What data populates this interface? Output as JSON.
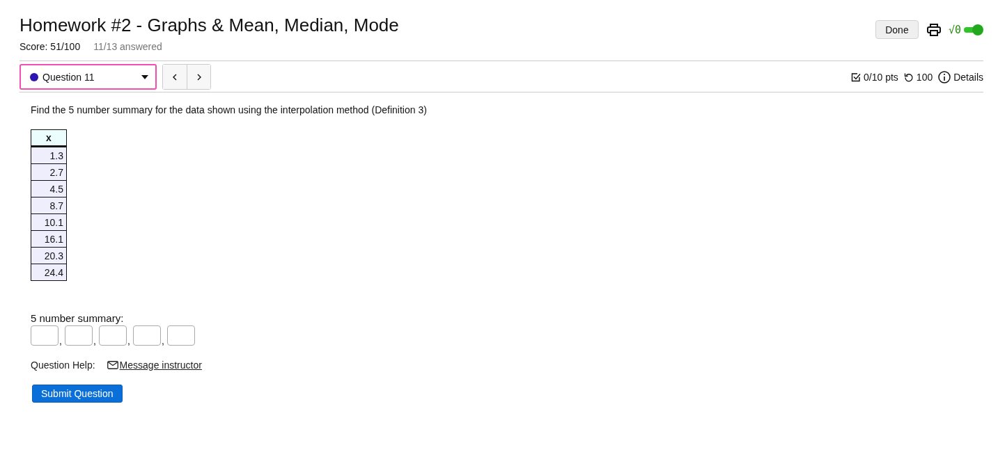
{
  "header": {
    "title": "Homework #2 - Graphs & Mean, Median, Mode",
    "score": "Score: 51/100",
    "answered": "11/13 answered",
    "done_button": "Done",
    "math_toggle": {
      "label": "√0",
      "on": true
    }
  },
  "question_bar": {
    "selector": {
      "label": "Question 11",
      "color": "#2b16b0"
    },
    "stats": {
      "points": "0/10 pts",
      "attempts": "100",
      "details": "Details"
    }
  },
  "question": {
    "prompt": "Find the 5 number summary for the data shown using the interpolation method (Definition 3)",
    "table": {
      "columns": [
        "x"
      ],
      "rows": [
        [
          "1.3"
        ],
        [
          "2.7"
        ],
        [
          "4.5"
        ],
        [
          "8.7"
        ],
        [
          "10.1"
        ],
        [
          "16.1"
        ],
        [
          "20.3"
        ],
        [
          "24.4"
        ]
      ]
    },
    "answer": {
      "label": "5 number summary:",
      "fields": [
        {
          "kind": "answer-box",
          "separator": ","
        },
        {
          "kind": "answer-box",
          "separator": ","
        },
        {
          "kind": "answer-box",
          "separator": ","
        },
        {
          "kind": "answer-box",
          "separator": ","
        },
        {
          "kind": "answer-box"
        }
      ]
    },
    "help": {
      "label": "Question Help:",
      "link": "Message instructor"
    },
    "submit_button": "Submit Question"
  }
}
